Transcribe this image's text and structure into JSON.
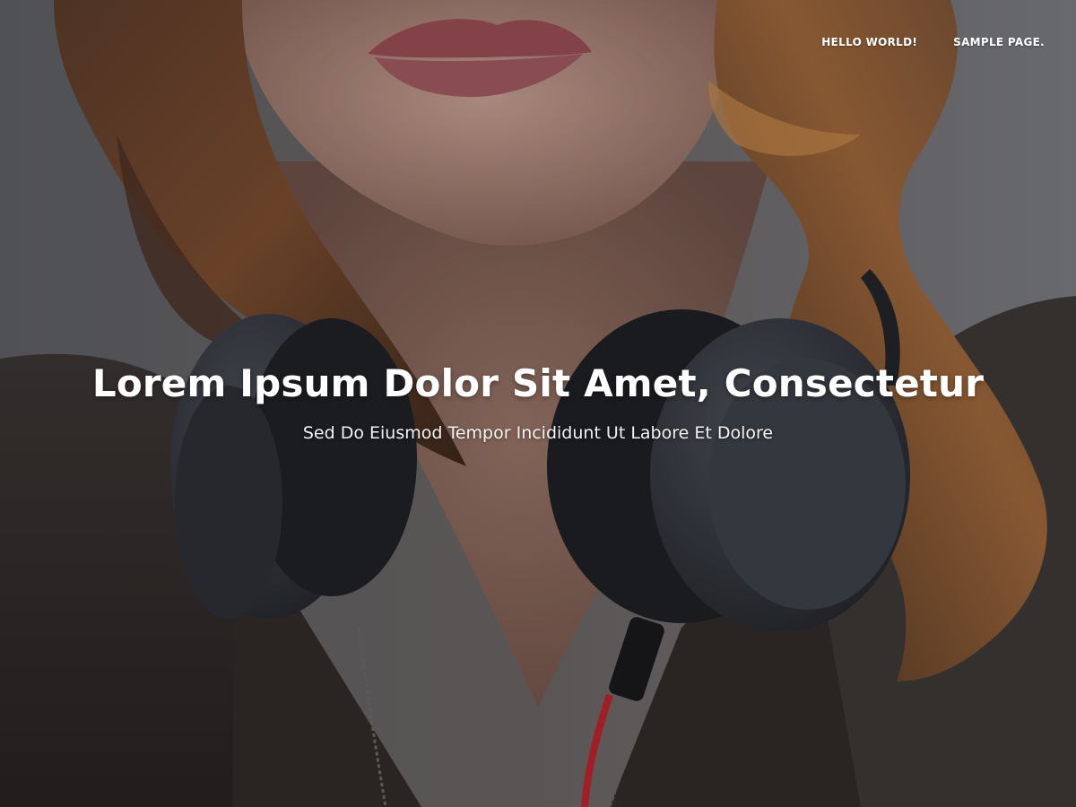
{
  "nav": {
    "items": [
      {
        "label": "HELLO WORLD!"
      },
      {
        "label": "SAMPLE PAGE."
      }
    ]
  },
  "hero": {
    "title": "Lorem Ipsum Dolor Sit Amet, Consectetur",
    "subtitle": "Sed Do Eiusmod Tempor Incididunt Ut Labore Et Dolore",
    "background_description_icon": "photo-woman-headphones"
  },
  "colors": {
    "text": "#ffffff",
    "hair": "#7a4a2c",
    "shirt": "#2e2a28",
    "headphones": "#2f343b",
    "cable_red": "#c0222b"
  }
}
